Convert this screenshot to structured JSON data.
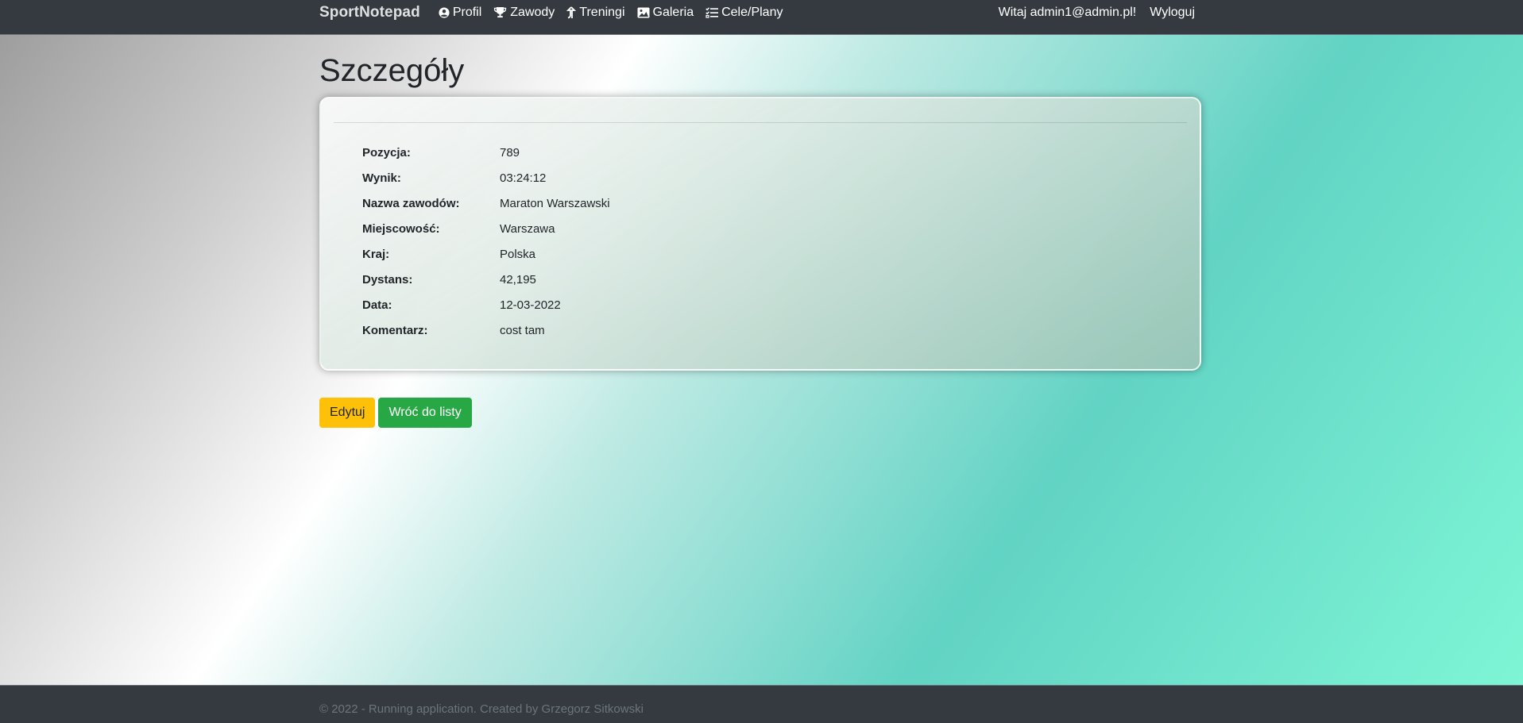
{
  "navbar": {
    "brand": "SportNotepad",
    "links": [
      {
        "label": "Profil",
        "icon": "user-circle-icon"
      },
      {
        "label": "Zawody",
        "icon": "trophy-icon"
      },
      {
        "label": "Treningi",
        "icon": "arrow-up-turn-icon"
      },
      {
        "label": "Galeria",
        "icon": "image-icon"
      },
      {
        "label": "Cele/Plany",
        "icon": "checklist-icon"
      }
    ],
    "welcome": "Witaj admin1@admin.pl!",
    "logout": "Wyloguj"
  },
  "page": {
    "title": "Szczegóły"
  },
  "details": [
    {
      "label": "Pozycja:",
      "value": "789"
    },
    {
      "label": "Wynik:",
      "value": "03:24:12"
    },
    {
      "label": "Nazwa zawodów:",
      "value": "Maraton Warszawski"
    },
    {
      "label": "Miejscowość:",
      "value": "Warszawa"
    },
    {
      "label": "Kraj:",
      "value": "Polska"
    },
    {
      "label": "Dystans:",
      "value": "42,195"
    },
    {
      "label": "Data:",
      "value": "12-03-2022"
    },
    {
      "label": "Komentarz:",
      "value": "cost tam"
    }
  ],
  "actions": {
    "edit": "Edytuj",
    "back": "Wróć do listy"
  },
  "footer": {
    "text": "© 2022 - Running application. Created by Grzegorz Sitkowski"
  },
  "colors": {
    "navbar": "#343a40",
    "warning": "#ffc107",
    "success": "#28a745"
  }
}
